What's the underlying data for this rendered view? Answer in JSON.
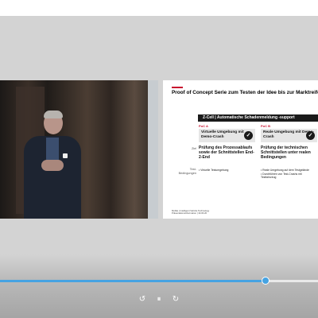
{
  "player": {
    "progress_fraction": 0.835,
    "accent_color": "#46a3e2",
    "controls": {
      "rewind_icon": "rewind-10-icon",
      "pause_icon": "pause-icon",
      "forward_icon": "forward-10-icon",
      "rewind_glyph": "↺",
      "pause_glyph": "⏸",
      "forward_glyph": "↻"
    }
  },
  "slide": {
    "title": "Proof of Concept Serie zum Testen der Idee bis zur Marktreife",
    "header": "Z-Cell | Automatische Schadenmeldung -support",
    "columns": [
      {
        "tag": "PoC A",
        "name": "Virtuelle Umgebung mit Demo-Crash",
        "goal": "Prüfung des Prozessablaufs sowie der Schnittstellen End-2-End",
        "bullets": [
          "• Virtuelle Testumgebung"
        ]
      },
      {
        "tag": "PoC B",
        "name": "Reale Umgebung mit Demo-Crash",
        "goal": "Prüfung der technischen Schnittstellen unter realen Bedingungen",
        "bullets": [
          "• Reale Umgebung auf dem Testgelände",
          "• Durchführen von Test-Crashs mit Testfahrzeug"
        ]
      }
    ],
    "row_labels": {
      "goal": "Ziel",
      "conditions": "Test-\nBedingungen"
    },
    "footer": "Mobile | Intelligent Vehicle Technology\nPräsentationsinformation | 19.03.20"
  }
}
